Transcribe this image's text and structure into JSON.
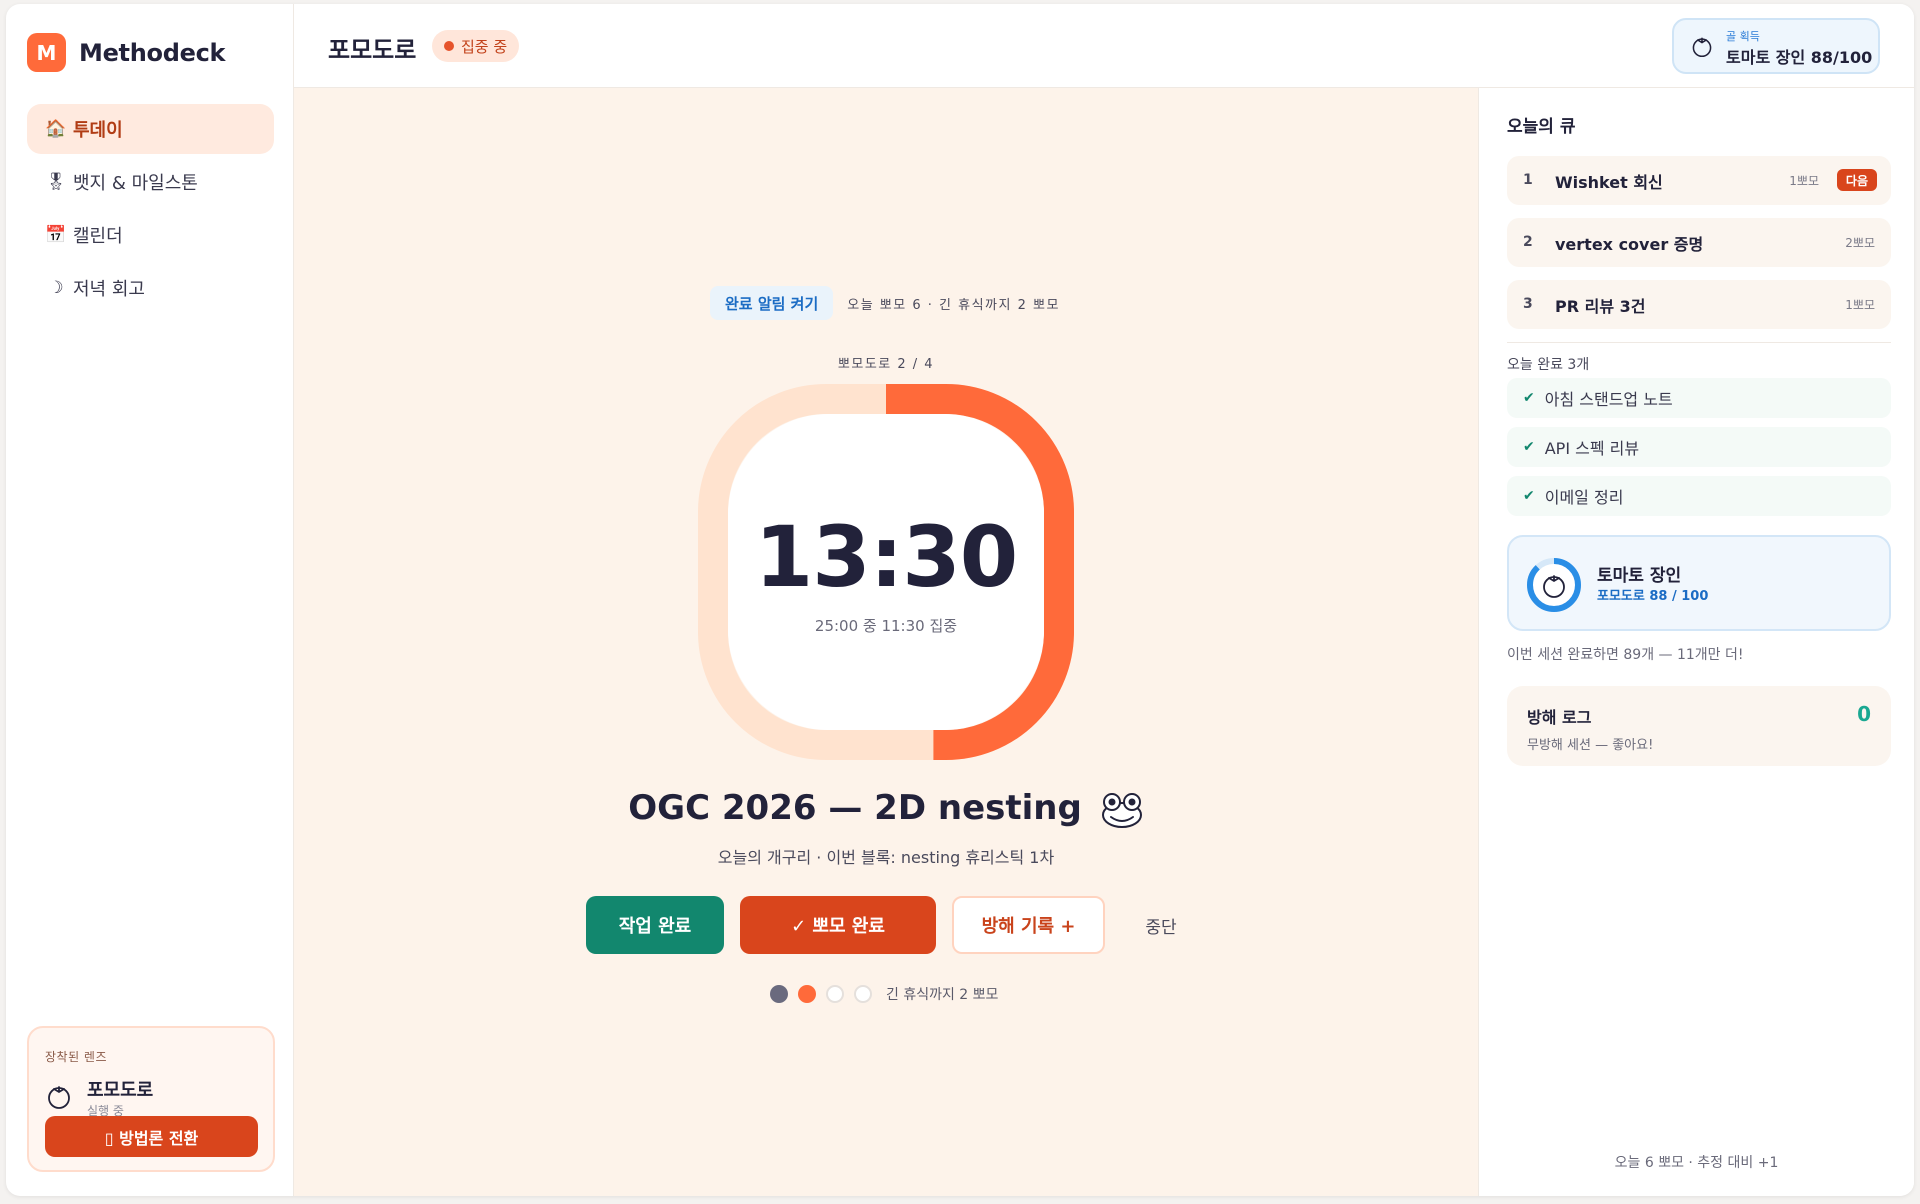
{
  "brand": {
    "logo_letter": "M",
    "name": "Methodeck",
    "accent": "#ff6a3a"
  },
  "sidebar": {
    "items": [
      {
        "icon": "home-icon",
        "glyph": "🏠",
        "label": "투데이",
        "active": true
      },
      {
        "icon": "medal-icon",
        "glyph": "🎖",
        "label": "뱃지 & 마일스톤",
        "active": false
      },
      {
        "icon": "calendar-icon",
        "glyph": "📅",
        "label": "캘린더",
        "active": false
      },
      {
        "icon": "moon-icon",
        "glyph": "☽",
        "label": "저녁 회고",
        "active": false
      }
    ],
    "lens": {
      "label": "장착된 렌즈",
      "title": "포모도로",
      "status": "실행 중",
      "switch_label": "▯ 방법론 전환"
    }
  },
  "header": {
    "title": "포모도로",
    "status": "집중 중",
    "goal": {
      "kicker": "골 획득",
      "text": "토마토 장인 88/100"
    }
  },
  "timer": {
    "notify_label": "완료 알림 켜기",
    "today_summary": "오늘 뽀모 6 · 긴 휴식까지 2 뽀모",
    "round_label": "뽀모도로 2 / 4",
    "time": "13:30",
    "time_sub": "25:00 중 11:30 집중",
    "progress_fraction": 0.46,
    "task_title": "OGC 2026 — 2D nesting",
    "task_sub": "오늘의 개구리 · 이번 블록: nesting 휴리스틱 1차",
    "actions": {
      "task_done": "작업 완료",
      "pomo_done": "✓ 뽀모 완료",
      "distraction": "방해 기록 +",
      "stop": "중단"
    },
    "round_dots_label": "긴 휴식까지 2 뽀모"
  },
  "queue": {
    "title": "오늘의 큐",
    "items": [
      {
        "num": "1",
        "label": "Wishket 회신",
        "meta": "1뽀모",
        "next": "다음"
      },
      {
        "num": "2",
        "label": "vertex cover 증명",
        "meta": "2뽀모"
      },
      {
        "num": "3",
        "label": "PR 리뷰 3건",
        "meta": "1뽀모"
      }
    ],
    "done_title": "오늘 완료 3개",
    "done": [
      "아침 스탠드업 노트",
      "API 스펙 리뷰",
      "이메일 정리"
    ]
  },
  "badge": {
    "title": "토마토 장인",
    "progress": "포모도로 88 / 100",
    "progress_fraction": 0.88,
    "note": "이번 세션 완료하면 89개 — 11개만 더!"
  },
  "distractions": {
    "title": "방해 로그",
    "count": "0",
    "sub": "무방해 세션 — 좋아요!"
  },
  "footer": "오늘 6 뽀모 · 추정 대비 +1",
  "colors": {
    "primary": "#d9451c",
    "success": "#12876e",
    "ring": "#ff6a3a",
    "ring_track": "#ffe3cf",
    "info": "#1b6cc4"
  }
}
